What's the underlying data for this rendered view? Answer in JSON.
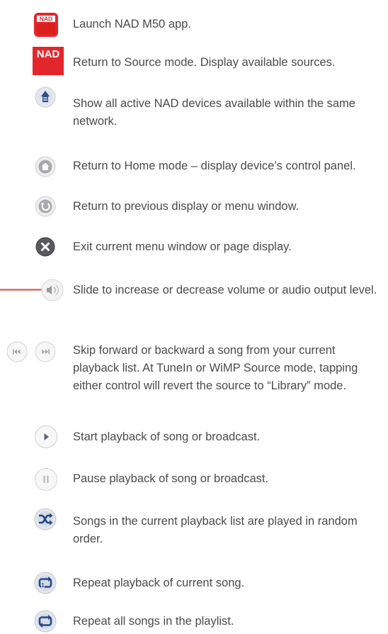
{
  "items": [
    {
      "icon": "nad-app-icon",
      "text": "Launch NAD M50 app."
    },
    {
      "icon": "nad-logo-icon",
      "text": "Return to Source mode. Display available sources."
    },
    {
      "icon": "network-devices-icon",
      "text": "Show all active NAD devices available within the same network."
    },
    {
      "icon": "home-icon",
      "text": "Return to Home mode – display device’s control panel."
    },
    {
      "icon": "back-icon",
      "text": "Return to previous display or menu window."
    },
    {
      "icon": "close-icon",
      "text": "Exit current menu window or page display."
    },
    {
      "icon": "volume-slider-icon",
      "text": "Slide to increase or decrease volume or audio output level."
    },
    {
      "icon": "skip-buttons-icon",
      "text": "Skip forward or backward a song from your current playback list. At TuneIn or WiMP Source mode, tapping either control will revert the source to “Library” mode."
    },
    {
      "icon": "play-icon",
      "text": "Start playback of song or broadcast."
    },
    {
      "icon": "pause-icon",
      "text": "Pause playback of song or broadcast."
    },
    {
      "icon": "shuffle-icon",
      "text": "Songs in the current playback list are played in random order."
    },
    {
      "icon": "repeat-one-icon",
      "text": "Repeat playback of current song."
    },
    {
      "icon": "repeat-all-icon",
      "text": "Repeat all songs in the playlist."
    }
  ],
  "logo_text": "NAD",
  "colors": {
    "nad_red": "#e3262b",
    "text": "#4b4b4b",
    "button_grey": "#d9d9de"
  }
}
